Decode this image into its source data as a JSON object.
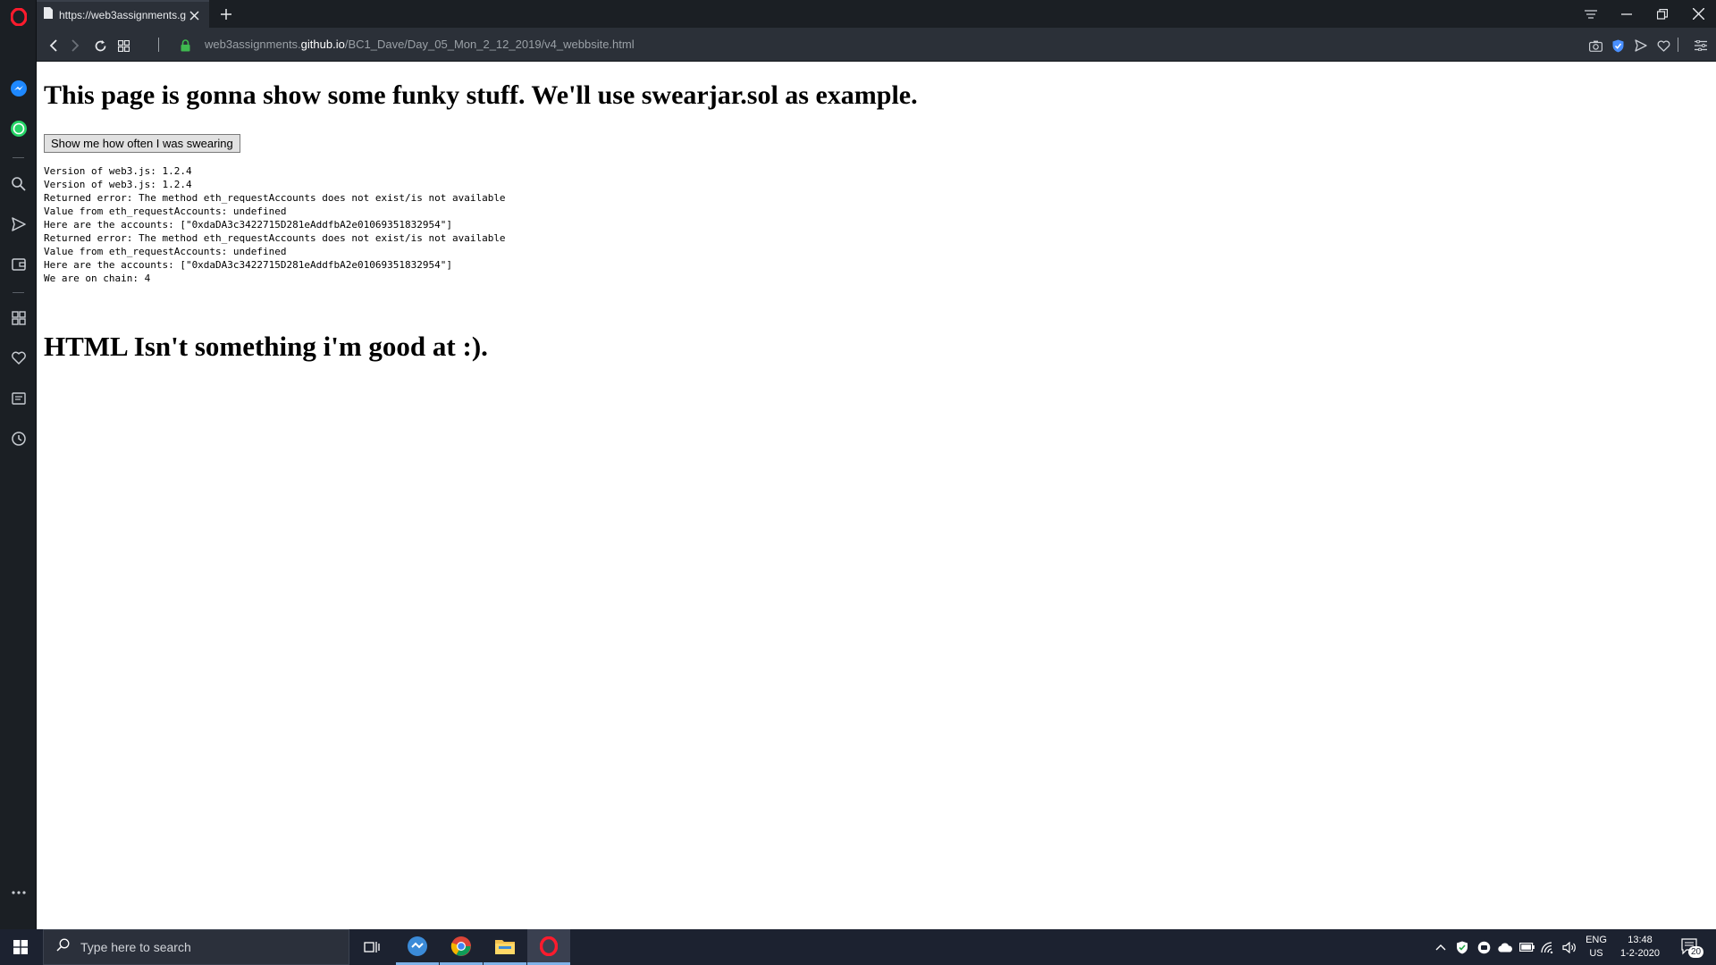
{
  "browser": {
    "tab_title": "https://web3assignments.g",
    "url_prefix": "web3assignments.",
    "url_domain": "github.io",
    "url_path": "/BC1_Dave/Day_05_Mon_2_12_2019/v4_webbsite.html"
  },
  "page": {
    "heading": "This page is gonna show some funky stuff. We'll use swearjar.sol as example.",
    "button_label": "Show me how often I was swearing",
    "log_lines": [
      "Version of web3.js: 1.2.4",
      "Version of web3.js: 1.2.4",
      "Returned error: The method eth_requestAccounts does not exist/is not available",
      "Value from eth_requestAccounts: undefined",
      "Here are the accounts: [\"0xdaDA3c3422715D281eAddfbA2e01069351832954\"]",
      "Returned error: The method eth_requestAccounts does not exist/is not available",
      "Value from eth_requestAccounts: undefined",
      "Here are the accounts: [\"0xdaDA3c3422715D281eAddfbA2e01069351832954\"]",
      "We are on chain: 4"
    ],
    "footer_heading": "HTML Isn't something i'm good at :)."
  },
  "taskbar": {
    "search_placeholder": "Type here to search",
    "lang_top": "ENG",
    "lang_bottom": "US",
    "time": "13:48",
    "date": "1-2-2020",
    "notification_count": "20"
  },
  "colors": {
    "sidebar_bg": "#1b1f24",
    "toolbar_bg": "#2b3038",
    "opera_red": "#ff1b2d",
    "taskbar_bg": "#1c2230",
    "lock_green": "#3fb950"
  }
}
